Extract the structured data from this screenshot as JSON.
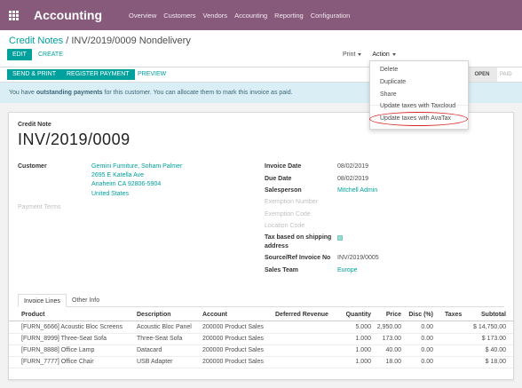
{
  "topbar": {
    "app_name": "Accounting",
    "menu": [
      "Overview",
      "Customers",
      "Vendors",
      "Accounting",
      "Reporting",
      "Configuration"
    ]
  },
  "control_panel": {
    "breadcrumb_parent": "Credit Notes",
    "breadcrumb_separator": " / ",
    "breadcrumb_current": "INV/2019/0009 Nondelivery",
    "edit_label": "EDIT",
    "create_label": "CREATE",
    "print_label": "Print",
    "action_label": "Action"
  },
  "action_menu": {
    "items": [
      "Delete",
      "Duplicate",
      "Share",
      "Update taxes with Taxcloud",
      "Update taxes with AvaTax"
    ]
  },
  "statusbar": {
    "send_print_label": "SEND & PRINT",
    "register_payment_label": "REGISTER PAYMENT",
    "preview_label": "PREVIEW",
    "stage_open": "OPEN",
    "stage_paid": "PAID"
  },
  "alert": {
    "prefix": "You have ",
    "bold": "outstanding payments",
    "suffix": " for this customer. You can allocate them to mark this invoice as paid."
  },
  "sheet": {
    "doc_type": "Credit Note",
    "doc_name": "INV/2019/0009",
    "customer_label": "Customer",
    "customer_lines": [
      "Gemini Furniture, Soham Palmer",
      "2695 E Katella Ave",
      "Anaheim CA 92806-5904",
      "United States"
    ],
    "payment_terms_label": "Payment Terms",
    "invoice_date_label": "Invoice Date",
    "invoice_date": "08/02/2019",
    "due_date_label": "Due Date",
    "due_date": "08/02/2019",
    "salesperson_label": "Salesperson",
    "salesperson": "Mitchell Admin",
    "exemption_number_label": "Exemption Number",
    "exemption_code_label": "Exemption Code",
    "location_code_label": "Location Code",
    "tax_shipping_label_1": "Tax based on shipping",
    "tax_shipping_label_2": "address",
    "source_ref_label": "Source/Ref Invoice No",
    "source_ref": "INV/2019/0005",
    "sales_team_label": "Sales Team",
    "sales_team": "Europe"
  },
  "tabs": {
    "invoice_lines": "Invoice Lines",
    "other_info": "Other Info"
  },
  "table": {
    "headers": {
      "product": "Product",
      "description": "Description",
      "account": "Account",
      "deferred_revenue": "Deferred Revenue",
      "quantity": "Quantity",
      "price": "Price",
      "disc": "Disc (%)",
      "taxes": "Taxes",
      "subtotal": "Subtotal"
    },
    "rows": [
      {
        "product": "[FURN_6666] Acoustic Bloc Screens",
        "description": "Acoustic Bloc Panel",
        "account": "200000 Product Sales",
        "quantity": "5.000",
        "price": "2,950.00",
        "disc": "0.00",
        "subtotal": "$ 14,750.00"
      },
      {
        "product": "[FURN_8999] Three-Seat Sofa",
        "description": "Three-Seat Sofa",
        "account": "200000 Product Sales",
        "quantity": "1.000",
        "price": "173.00",
        "disc": "0.00",
        "subtotal": "$ 173.00"
      },
      {
        "product": "[FURN_8888] Office Lamp",
        "description": "Datacard",
        "account": "200000 Product Sales",
        "quantity": "1.000",
        "price": "40.00",
        "disc": "0.00",
        "subtotal": "$ 40.00"
      },
      {
        "product": "[FURN_7777] Office Chair",
        "description": "USB Adapter",
        "account": "200000 Product Sales",
        "quantity": "1.000",
        "price": "18.00",
        "disc": "0.00",
        "subtotal": "$ 18.00"
      }
    ]
  },
  "colors": {
    "brand": "#875a7b",
    "accent": "#00a09d",
    "alert_bg": "#d9eef5",
    "annotation": "#d62828"
  }
}
